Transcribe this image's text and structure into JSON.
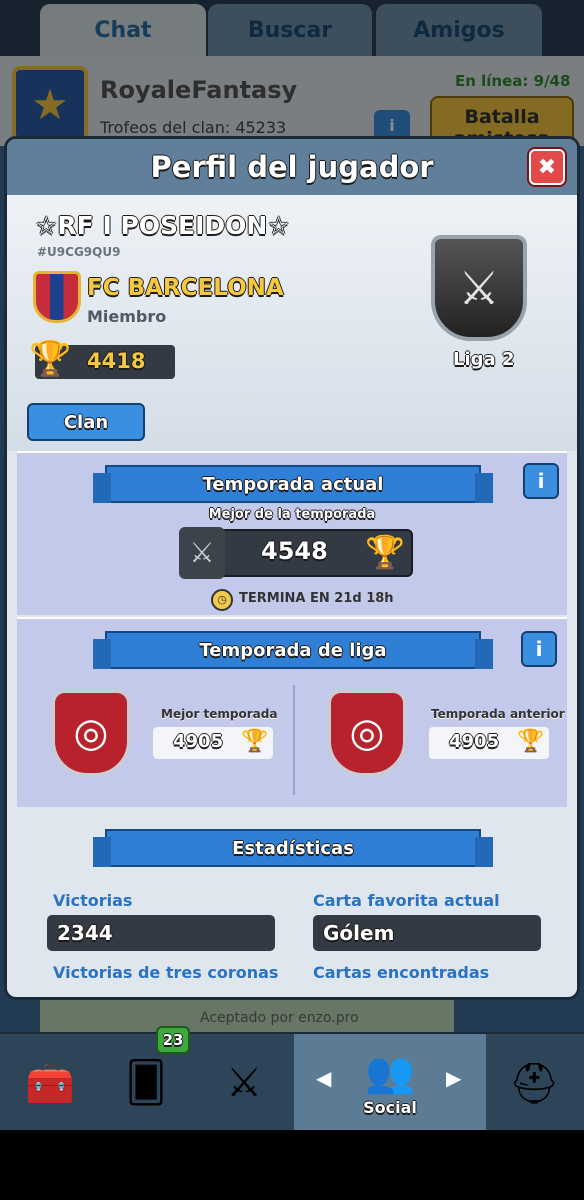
{
  "top_tabs": [
    "Chat",
    "Buscar",
    "Amigos"
  ],
  "clan": {
    "name": "RoyaleFantasy",
    "trophies_text": "Trofeos del clan:   45233",
    "online_text": "En línea: 9/48",
    "batalla_label": "Batalla amistosa",
    "info_icon": "i"
  },
  "chat_message": "Aceptado por enzo.pro",
  "bottom_nav": {
    "cards_badge": "23",
    "social_label": "Social"
  },
  "modal": {
    "title": "Perfil del jugador",
    "close_icon": "✖",
    "player": {
      "name": "☆RF I POSEIDON☆",
      "tag": "#U9CG9QU9",
      "clan_name": "FC BARCELONA",
      "role": "Miembro",
      "trophies": "4418",
      "league": "Liga 2"
    },
    "clan_button": "Clan",
    "current_season": {
      "title": "Temporada actual",
      "best_label": "Mejor de la temporada",
      "best_value": "4548",
      "ends_text": "TERMINA EN 21d 18h"
    },
    "league_season": {
      "title": "Temporada de liga",
      "best_label": "Mejor temporada",
      "best_value": "4905",
      "previous_label": "Temporada anterior",
      "previous_value": "4905"
    },
    "stats": {
      "title": "Estadísticas",
      "wins_label": "Victorias",
      "wins_value": "2344",
      "favorite_label": "Carta favorita actual",
      "favorite_value": "Gólem",
      "three_crown_label": "Victorias de tres coronas",
      "cards_found_label": "Cartas encontradas"
    }
  },
  "colors": {
    "accent_blue": "#3b8fe0",
    "gold": "#f2b934",
    "close_red": "#e24a4a"
  }
}
